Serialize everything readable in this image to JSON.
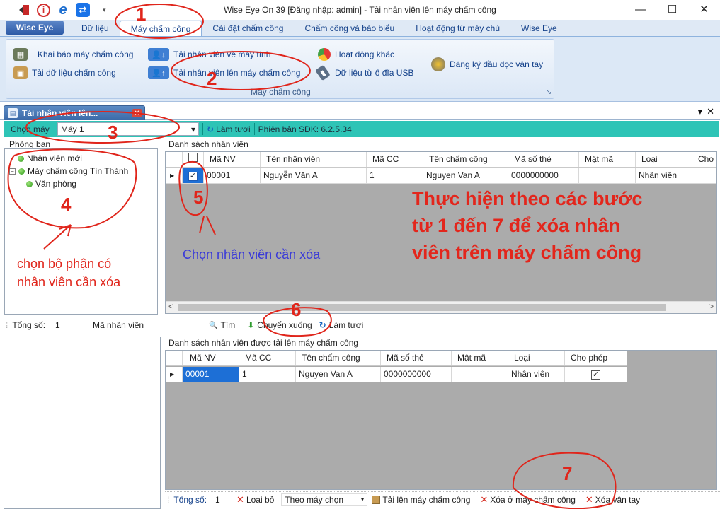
{
  "window": {
    "title": "Wise Eye On 39 [Đăng nhập: admin] - Tải nhân viên lên máy chấm công",
    "minimize_glyph": "—",
    "maximize_glyph": "☐",
    "close_glyph": "✕"
  },
  "quick_access": {
    "icons": [
      "logout-icon",
      "info-icon",
      "ie-icon",
      "teamviewer-icon"
    ],
    "info_glyph": "i",
    "ie_glyph": "e",
    "teamviewer_glyph": "⇄",
    "dropdown_glyph": "▾"
  },
  "ribbon": {
    "app_button": "Wise Eye",
    "tabs": [
      "Dữ liệu",
      "Máy chấm công",
      "Cài đặt chấm công",
      "Chấm công và báo biểu",
      "Hoạt động từ máy chủ",
      "Wise Eye"
    ],
    "active_tab": "Máy chấm công",
    "buttons": {
      "declare_machine": "Khai báo máy chấm công",
      "download_data": "Tải dữ liệu chấm công",
      "download_staff": "Tải nhân viên về máy tính",
      "upload_staff": "Tải nhân viên lên máy chấm công",
      "other_activity": "Hoạt động khác",
      "usb_data": "Dữ liệu từ ổ đĩa USB",
      "register_reader": "Đăng ký đầu đọc vân tay"
    },
    "group_label": "Máy chấm công",
    "launcher_glyph": "↘"
  },
  "document_tab": {
    "label": "Tải nhân viên lên...",
    "close_glyph": "✕",
    "pin_glyph": "▾",
    "close_panel_glyph": "✕"
  },
  "machine_bar": {
    "label": "Chọn máy",
    "selected": "Máy 1",
    "dropdown_glyph": "▾",
    "refresh": "Làm tươi",
    "sdk": "Phiên bản SDK: 6.2.5.34"
  },
  "department": {
    "title": "Phòng ban",
    "nodes": [
      "Nhân viên mới",
      "Máy chấm công Tín Thành",
      "Văn phòng"
    ],
    "expander_glyph": "−"
  },
  "staff_list": {
    "title": "Danh sách nhân viên",
    "columns": [
      "Mã NV",
      "Tên nhân viên",
      "Mã CC",
      "Tên chấm công",
      "Mã số thẻ",
      "Mật mã",
      "Loại",
      "Cho"
    ],
    "rows": [
      {
        "checked": true,
        "ma_nv": "00001",
        "ten_nv": "Nguyễn Văn A",
        "ma_cc": "1",
        "ten_cc": "Nguyen Van A",
        "ma_the": "0000000000",
        "mat_ma": "",
        "loai": "Nhân viên",
        "cho": ""
      }
    ],
    "row_marker": "▶",
    "check_glyph": "✓",
    "scroll_left": "<",
    "scroll_right": ">"
  },
  "middle_bar": {
    "total_label": "Tổng số:",
    "total_value": "1",
    "staff_code_label": "Mã nhân viên",
    "search": "Tìm",
    "move_down": "Chuyển xuống",
    "refresh": "Làm tươi",
    "search_glyph": "🔍",
    "move_down_glyph": "⬇",
    "refresh_glyph": "↻"
  },
  "uploaded_list": {
    "title": "Danh sách nhân viên được tải lên máy chấm công",
    "columns": [
      "Mã NV",
      "Mã CC",
      "Tên chấm công",
      "Mã số thẻ",
      "Mật mã",
      "Loại",
      "Cho phép"
    ],
    "rows": [
      {
        "ma_nv": "00001",
        "ma_cc": "1",
        "ten_cc": "Nguyen Van A",
        "ma_the": "0000000000",
        "mat_ma": "",
        "loai": "Nhân viên",
        "cho_phep": true
      }
    ],
    "row_marker": "▶",
    "check_glyph": "✓"
  },
  "bottom_bar": {
    "total_label": "Tổng số:",
    "total_value": "1",
    "remove": "Loại bỏ",
    "by_machine": "Theo máy chọn",
    "upload": "Tải lên máy chấm công",
    "delete_on_machine": "Xóa ở máy chấm công",
    "delete_fingerprint": "Xóa vân tay",
    "x_glyph": "✕",
    "dropdown_glyph": "▾"
  },
  "annotations": {
    "numbers": [
      "1",
      "2",
      "3",
      "4",
      "5",
      "6",
      "7"
    ],
    "note_department": [
      "chọn bộ phận có",
      "nhân viên cần xóa"
    ],
    "note_staff": "Chọn nhân viên cần xóa",
    "instructions": [
      "Thực hiện theo các bước",
      "từ 1 đến 7 để xóa nhân",
      "viên trên máy chấm công"
    ]
  },
  "colors": {
    "annotation_red": "#e0251b",
    "note_blue": "#3a3ad8",
    "machine_bar_teal": "#2ec4b6",
    "ribbon_blue": "#dce8f6",
    "selection_blue": "#1d6fd6"
  }
}
